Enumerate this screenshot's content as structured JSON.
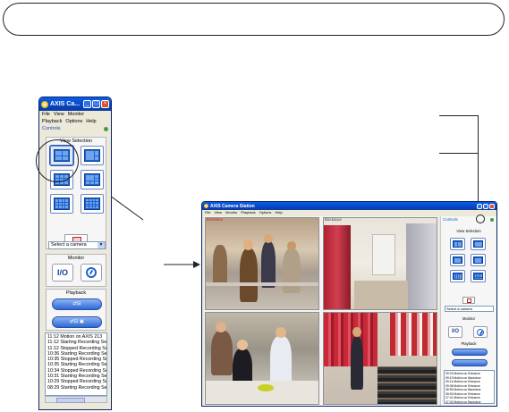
{
  "small_window": {
    "title": "AXIS Ca...",
    "menu_row1": [
      "File",
      "View",
      "Monitor"
    ],
    "menu_row2": [
      "Playback",
      "Options",
      "Help"
    ],
    "controls_label": "Controls",
    "view_selection_label": "View Selection",
    "select_camera": "Select a camera",
    "monitor_label": "Monitor",
    "io_label": "I/O",
    "playback_label": "Playback",
    "log": [
      "11:12 Motion on AXIS 213",
      "11:12 Starting Recording Serv",
      "11:12 Stopped Recording Serv",
      "10:36 Starting Recording Serv",
      "10:35 Stopped Recording Serv",
      "10:35 Starting Recording Serv",
      "10:34 Stopped Recording Serv",
      "10:31 Starting Recording Serv",
      "10:29 Stopped Recording Serv",
      "08:29 Starting Recording Serv"
    ]
  },
  "large_window": {
    "title": "AXIS Camera Station",
    "menu": [
      "File",
      "View",
      "Monitor",
      "Playback",
      "Options",
      "Help"
    ],
    "camera_labels": [
      "Entrance",
      "Backdoor",
      "",
      ""
    ],
    "controls_label": "Controls",
    "view_selection_label": "View Selection",
    "select_camera": "Select a camera",
    "monitor_label": "Monitor",
    "io_label": "I/O",
    "playback_label": "Playback",
    "log": [
      "09:23 Motion on Entrance",
      "09:19 Motion on Backdoor",
      "09:14 Motion on Entrance",
      "09:08 Motion on Entrance",
      "08:59 Motion on Backdoor",
      "08:53 Motion on Entrance",
      "07:41 Motion on Entrance",
      "07:32 Motion on Backdoor"
    ]
  },
  "colors": {
    "xp_title": "#0a5ee8",
    "accent_blue": "#1e64d0",
    "label_red": "#c02020",
    "window_bg": "#ece9d8"
  }
}
